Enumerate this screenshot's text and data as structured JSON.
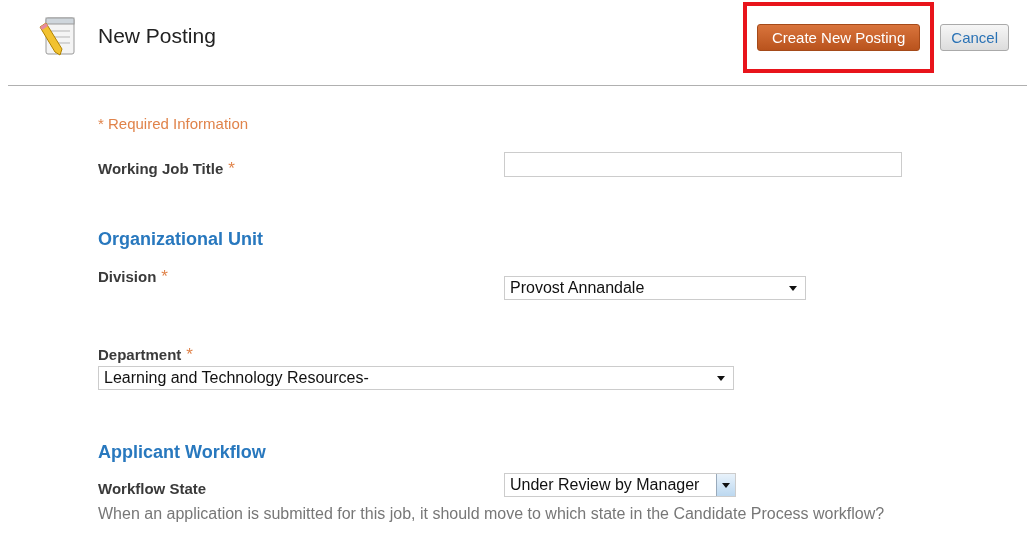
{
  "header": {
    "title": "New Posting",
    "primary_button": "Create New Posting",
    "cancel_button": "Cancel",
    "primary_highlighted": true
  },
  "form": [
    {
      "kind": "note",
      "text": "* Required Information"
    },
    {
      "kind": "text-field",
      "label": "Working Job Title",
      "required_mark": "*"
    },
    {
      "kind": "heading",
      "text": "Organizational Unit"
    },
    {
      "kind": "select",
      "label": "Division",
      "required_mark": "*",
      "value": "Provost Annandale"
    },
    {
      "kind": "wide-select",
      "label": "Department",
      "required_mark": "*",
      "value": "Learning and Technology Resources-"
    },
    {
      "kind": "heading",
      "text": "Applicant Workflow"
    },
    {
      "kind": "combo",
      "label": "Workflow State",
      "value": "Under Review by Manager"
    },
    {
      "kind": "help",
      "text": "When an application is submitted for this job, it should move to which state in the Candidate Process workflow?"
    }
  ]
}
